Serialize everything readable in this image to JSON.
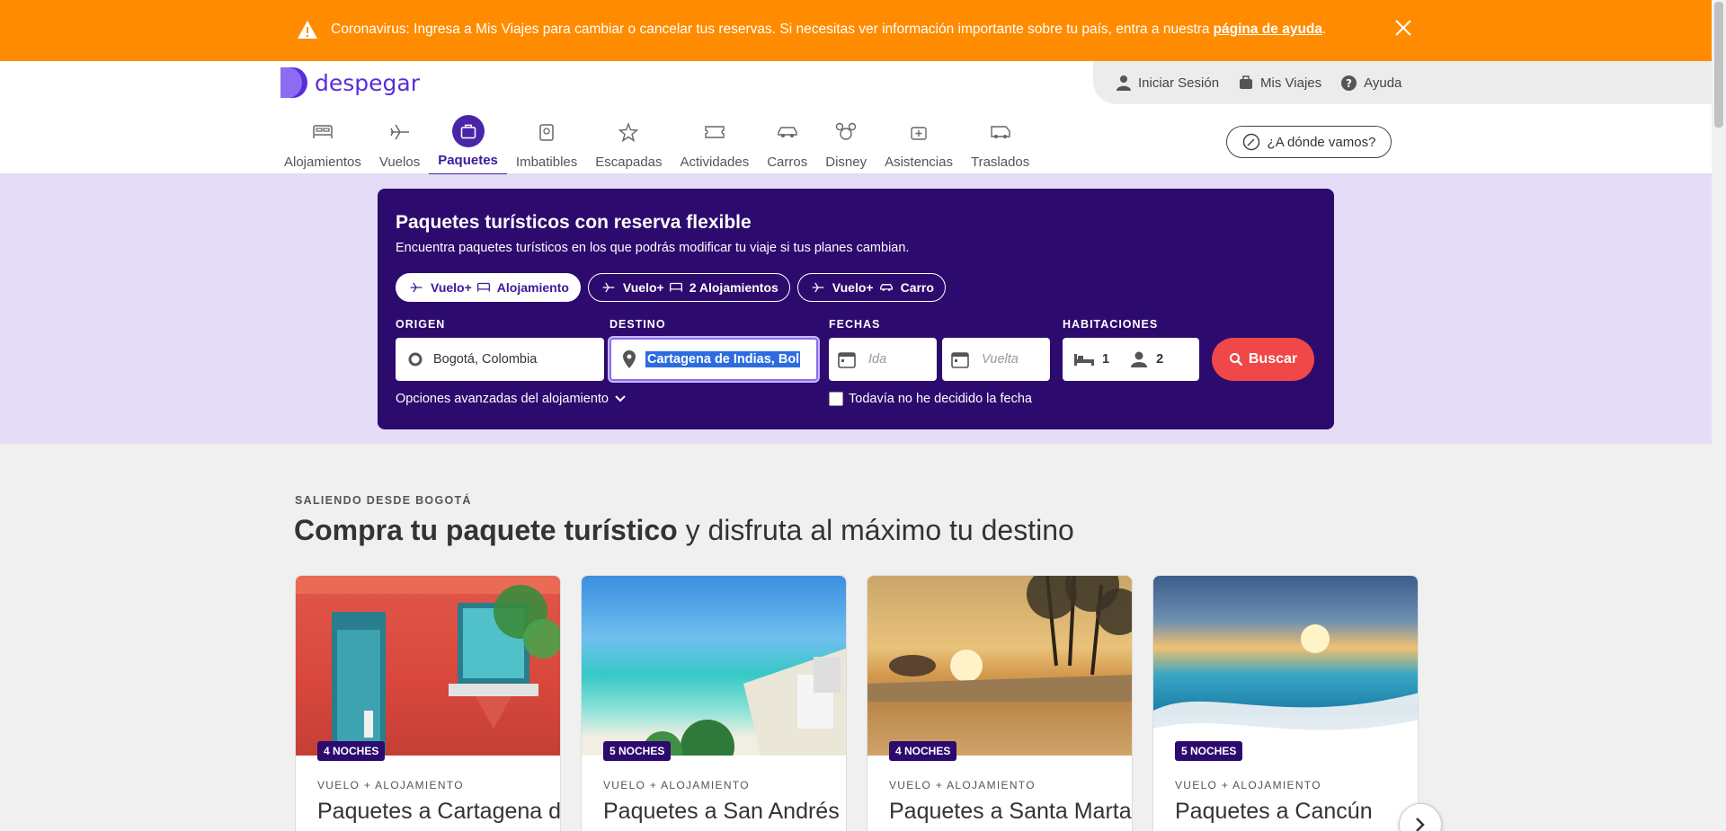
{
  "banner": {
    "text": "Coronavirus: Ingresa a Mis Viajes para cambiar o cancelar tus reservas. Si necesitas ver información importante sobre tu país, entra a nuestra",
    "link": "página de ayuda",
    "after": "."
  },
  "header": {
    "logo": "despegar",
    "user_menu": [
      {
        "label": "Iniciar Sesión",
        "icon": "user-icon"
      },
      {
        "label": "Mis Viajes",
        "icon": "suitcase-icon"
      },
      {
        "label": "Ayuda",
        "icon": "help-icon"
      }
    ],
    "nav": [
      {
        "label": "Alojamientos",
        "icon": "bed-icon"
      },
      {
        "label": "Vuelos",
        "icon": "plane-icon"
      },
      {
        "label": "Paquetes",
        "icon": "package-icon",
        "active": true
      },
      {
        "label": "Imbatibles",
        "icon": "tag-icon"
      },
      {
        "label": "Escapadas",
        "icon": "star-icon"
      },
      {
        "label": "Actividades",
        "icon": "ticket-icon"
      },
      {
        "label": "Carros",
        "icon": "car-icon"
      },
      {
        "label": "Disney",
        "icon": "mickey-icon"
      },
      {
        "label": "Asistencias",
        "icon": "aid-icon"
      },
      {
        "label": "Traslados",
        "icon": "shuttle-icon"
      }
    ],
    "where_button": "¿A dónde vamos?"
  },
  "search": {
    "title": "Paquetes turísticos con reserva flexible",
    "subtitle": "Encuentra paquetes turísticos en los que podrás modificar tu viaje si tus planes cambian.",
    "pills": [
      {
        "a": "Vuelo",
        "b": "Alojamiento"
      },
      {
        "a": "Vuelo",
        "b": "2 Alojamientos"
      },
      {
        "a": "Vuelo",
        "b": "Carro"
      }
    ],
    "labels": {
      "origin": "ORIGEN",
      "destination": "DESTINO",
      "dates": "FECHAS",
      "rooms": "HABITACIONES"
    },
    "origin_value": "Bogotá, Colombia",
    "destination_value": "Cartagena de Indias, Bolí",
    "ida_placeholder": "Ida",
    "vuelta_placeholder": "Vuelta",
    "rooms_count": "1",
    "people_count": "2",
    "search_button": "Buscar",
    "advanced": "Opciones avanzadas del alojamiento",
    "undecided": "Todavía no he decidido la fecha"
  },
  "content": {
    "eyebrow": "SALIENDO DESDE BOGOTÁ",
    "headline_bold": "Compra tu paquete turístico",
    "headline_rest": " y disfruta al máximo tu destino",
    "cards": [
      {
        "badge": "4 NOCHES",
        "kind": "VUELO + ALOJAMIENTO",
        "title": "Paquetes a Cartagena de Indias"
      },
      {
        "badge": "5 NOCHES",
        "kind": "VUELO + ALOJAMIENTO",
        "title": "Paquetes a San Andrés"
      },
      {
        "badge": "4 NOCHES",
        "kind": "VUELO + ALOJAMIENTO",
        "title": "Paquetes a Santa Marta"
      },
      {
        "badge": "5 NOCHES",
        "kind": "VUELO + ALOJAMIENTO",
        "title": "Paquetes a Cancún"
      }
    ]
  },
  "colors": {
    "banner": "#ff8c00",
    "brand": "#5a2ddc",
    "search_bg": "#2d0a6e",
    "hero_bg": "#e5ddf7",
    "cta": "#f04848"
  }
}
